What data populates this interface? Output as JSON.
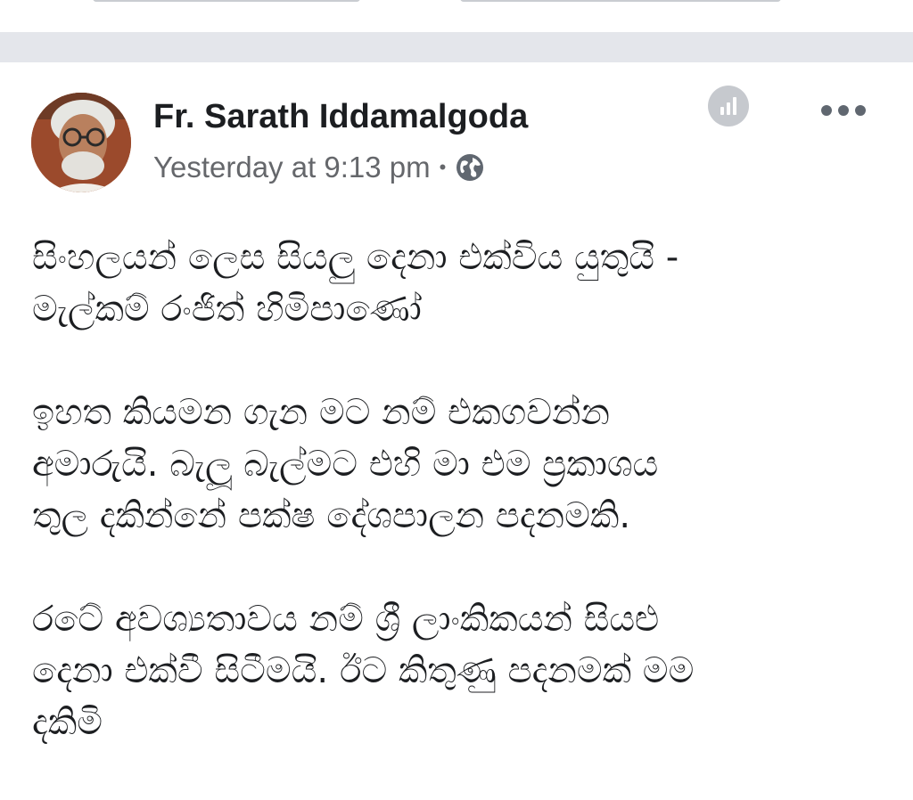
{
  "post": {
    "author_name": "Fr. Sarath Iddamalgoda",
    "timestamp": "Yesterday at 9:13 pm",
    "separator_dot": "•",
    "audience_icon": "globe-icon",
    "insights_icon": "bar-chart-icon",
    "more_icon": "more-horizontal-icon",
    "paragraphs": [
      {
        "lines": [
          "සිංහලයන් ලෙස සියලු දෙනා එක්විය යුතුයි -",
          "මැල්කම් රංජිත් හිමිපාණෝ"
        ]
      },
      {
        "lines": [
          "ඉහත කියමන ගැන මට නම් එකගවන්න",
          "අමාරුයි. බැලූ බැල්මට එහි මා එම ප්‍රකාශය",
          "තුල දකින්නේ පක්ෂ දේශපාලන පදනමකි."
        ]
      },
      {
        "lines": [
          "රටේ අවශ්‍යතාවය නම් ශ්‍රී ලාංකිකයන් සියළු",
          "දෙනා එක්වී සිටීමයි. ඊට කිතුණු පදනමක් මම",
          "දකිමි"
        ]
      }
    ]
  },
  "colors": {
    "separator": "#e4e6eb",
    "text_primary": "#1c1e21",
    "text_secondary": "#65676b",
    "icon_gray": "#606770"
  }
}
